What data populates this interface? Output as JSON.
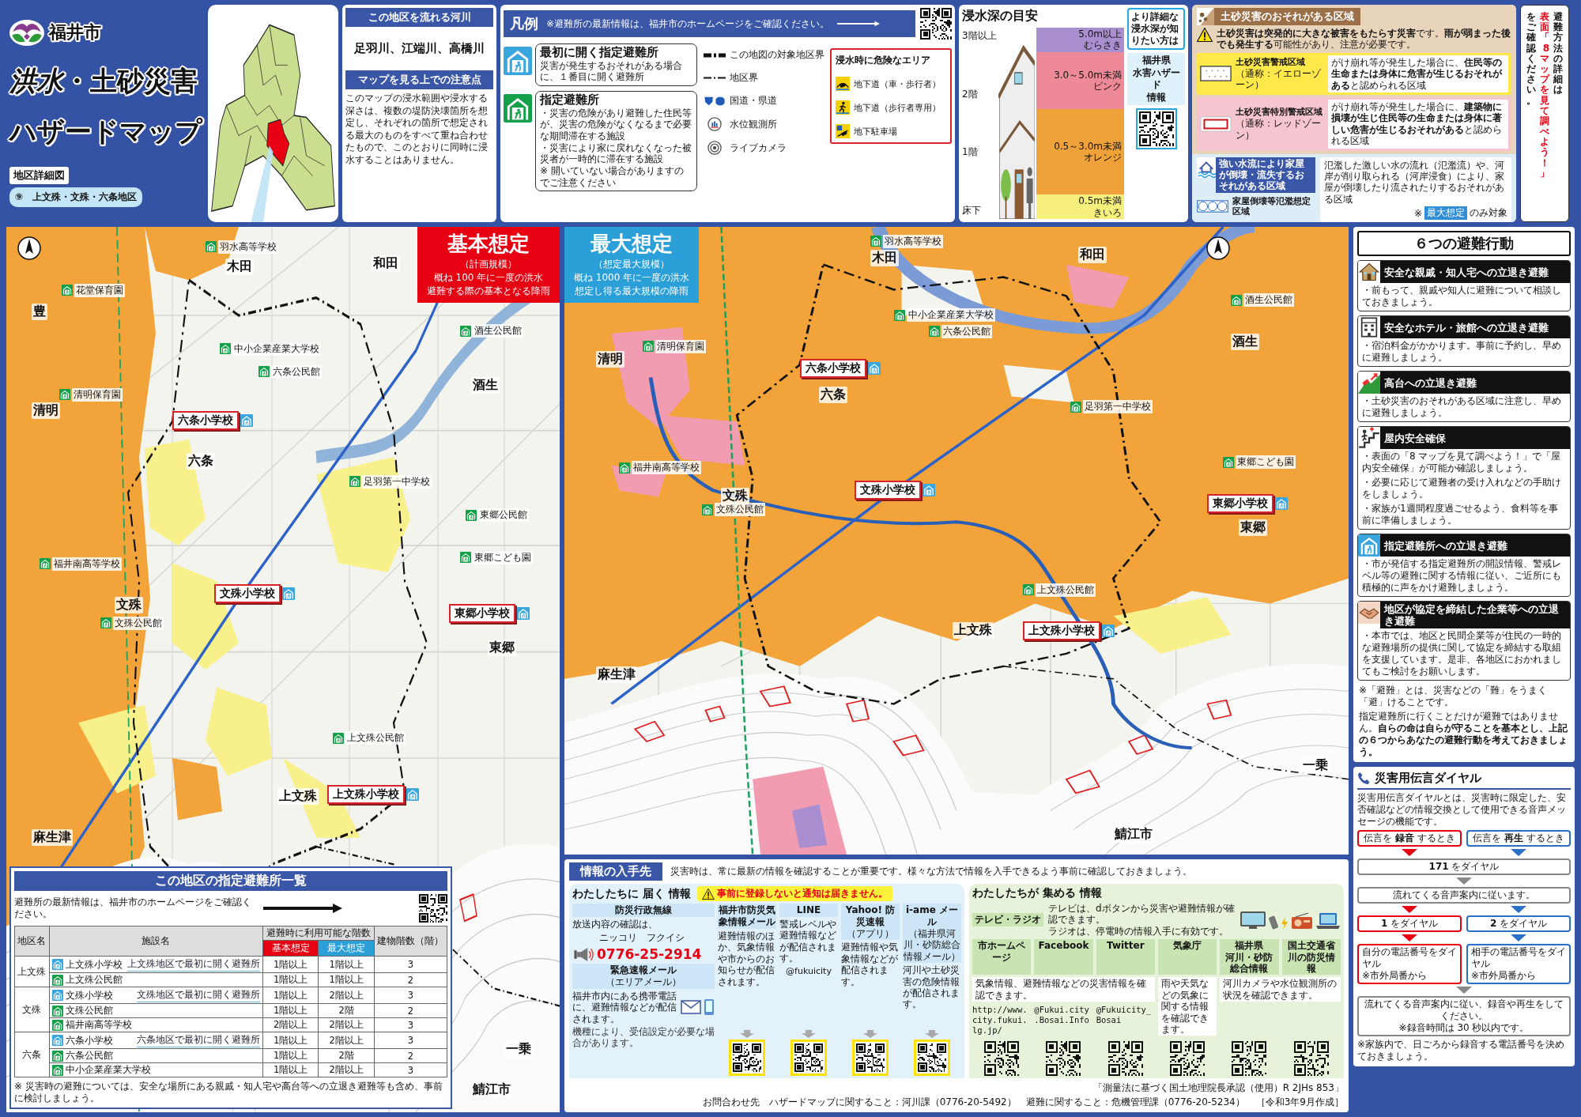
{
  "header": {
    "city": "福井市",
    "title": "*洪水*・**土砂災害**",
    "subtitle": "ハザードマップ",
    "map_type": "地区詳細図",
    "district": "⑨　上文殊・文殊・六条地区"
  },
  "rivers": {
    "heading": "この地区を流れる河川",
    "names": "足羽川、江端川、高橋川"
  },
  "caution": {
    "heading": "マップを見る上での注意点",
    "text": "このマップの浸水範囲や浸水する深さは、複数の堤防決壊箇所を想定し、それぞれの箇所で想定される最大のものをすべて重ね合わせたもので、このとおりに同時に浸水することはありません。"
  },
  "legend": {
    "heading": "凡例",
    "notice": "※避難所の最新情報は、福井市のホームページをご確認ください。",
    "shelters": [
      {
        "kind": "first",
        "title": "最初に開く指定避難所",
        "lines": [
          "災害が発生するおそれがある場合に、１番目に開く避難所"
        ]
      },
      {
        "kind": "designated",
        "title": "指定避難所",
        "lines": [
          "・災害の危険があり避難した住民等が、災害の危険がなくなるまで必要な期間滞在する施設",
          "・災害により家に戻れなくなった被災者が一時的に滞在する施設",
          "※ 開いていない場合がありますのでご注意ください"
        ]
      }
    ],
    "symbols": [
      {
        "kind": "target_boundary",
        "label": "この地図の対象地区界"
      },
      {
        "kind": "boundary",
        "label": "地区界"
      },
      {
        "kind": "road",
        "label": "国道・県道"
      },
      {
        "kind": "gauge",
        "label": "水位観測所"
      },
      {
        "kind": "camera",
        "label": "ライブカメラ"
      }
    ],
    "danger": {
      "heading": "浸水時に危険なエリア",
      "items": [
        {
          "kind": "underpass_car",
          "label": "地下道（車・歩行者）"
        },
        {
          "kind": "underpass_walk",
          "label": "地下道（歩行者専用）"
        },
        {
          "kind": "parking",
          "label": "地下駐車場"
        }
      ]
    }
  },
  "depth_guide": {
    "heading": "浸水深の目安",
    "floors": [
      "3階以上",
      "2階",
      "1階",
      "床下"
    ],
    "bands": [
      {
        "range": "5.0m以上",
        "name": "むらさき",
        "color": "#a98fcf"
      },
      {
        "range": "3.0～5.0m未満",
        "name": "ピンク",
        "color": "#ee8a98"
      },
      {
        "range": "0.5～3.0m未満",
        "name": "オレンジ",
        "color": "#f0a23a"
      },
      {
        "range": "0.5m未満",
        "name": "きいろ",
        "color": "#f6ef7c"
      }
    ],
    "callout": "より詳細な浸水深が知りたい方は",
    "link_lines": [
      "福井県",
      "水害ハザード",
      "情報"
    ]
  },
  "sediment": {
    "heading": "土砂災害のおそれがある区域",
    "warning": "**土砂災害は突発的に大きな被害をもたらす災害**です。**雨が弱まった後でも発生する**可能性があり、注意が必要です。",
    "zones": [
      {
        "kind": "warning",
        "name": "土砂災害警戒区域",
        "alias": "（通称：イエローゾーン）",
        "text": "がけ崩れ等が発生した場合に、**住民等の生命または身体に危害が生じるおそれがある**と認められる区域"
      },
      {
        "kind": "special_warning",
        "name": "土砂災害特別警戒区域",
        "alias": "（通称：レッドゾーン）",
        "text": "がけ崩れ等が発生した場合に、**建築物に損壊が生じ住民等の生命または身体に著しい危害が生じるおそれがある**と認められる区域"
      }
    ],
    "flow": {
      "heading": "強い水流により家屋が倒壊・流失するおそれがある区域",
      "name": "家屋倒壊等氾濫想定区域",
      "text": "氾濫した激しい水の流れ（氾濫流）や、河岸が削り取られる（河岸浸食）により、家屋が倒壊したり流されたりするおそれがある区域",
      "note_mark": "※",
      "note_badge": "最大想定",
      "note_text": "のみ対象"
    }
  },
  "side_note": {
    "text": "避難方法の詳細は**表面「8 マップを見て調べよう！」**をご確認ください。"
  },
  "maps": [
    {
      "kind": "basic",
      "title": "基本想定",
      "scale": "（計画規模）",
      "lines": [
        "概ね 100 年に一度の洪水",
        "避難する際の基本となる降雨"
      ],
      "labels": [
        {
          "kind": "facility",
          "text": "羽水高等学校"
        },
        {
          "kind": "area",
          "text": "木田"
        },
        {
          "kind": "area",
          "text": "和田"
        },
        {
          "kind": "facility",
          "text": "花堂保育園"
        },
        {
          "kind": "area",
          "text": "豊"
        },
        {
          "kind": "facility",
          "text": "中小企業産業大学校"
        },
        {
          "kind": "facility",
          "text": "酒生公民館"
        },
        {
          "kind": "facility",
          "text": "六条公民館"
        },
        {
          "kind": "facility",
          "text": "清明保育園"
        },
        {
          "kind": "area",
          "text": "清明"
        },
        {
          "kind": "area",
          "text": "酒生"
        },
        {
          "kind": "school",
          "text": "六条小学校"
        },
        {
          "kind": "area",
          "text": "六条"
        },
        {
          "kind": "facility",
          "text": "足羽第一中学校"
        },
        {
          "kind": "facility",
          "text": "東郷公民館"
        },
        {
          "kind": "facility",
          "text": "福井南高等学校"
        },
        {
          "kind": "facility",
          "text": "東郷こども園"
        },
        {
          "kind": "school",
          "text": "文殊小学校"
        },
        {
          "kind": "area",
          "text": "文殊"
        },
        {
          "kind": "facility",
          "text": "文殊公民館"
        },
        {
          "kind": "school",
          "text": "東郷小学校"
        },
        {
          "kind": "area",
          "text": "東郷"
        },
        {
          "kind": "facility",
          "text": "上文殊公民館"
        },
        {
          "kind": "area",
          "text": "上文殊"
        },
        {
          "kind": "school",
          "text": "上文殊小学校"
        },
        {
          "kind": "area",
          "text": "麻生津"
        },
        {
          "kind": "area",
          "text": "一乗"
        },
        {
          "kind": "area",
          "text": "鯖江市"
        }
      ]
    },
    {
      "kind": "max",
      "title": "最大想定",
      "scale": "（想定最大規模）",
      "lines": [
        "概ね 1000 年に一度の洪水",
        "想定し得る最大規模の降雨"
      ],
      "labels": [
        {
          "kind": "facility",
          "text": "羽水高等学校"
        },
        {
          "kind": "area",
          "text": "木田"
        },
        {
          "kind": "area",
          "text": "和田"
        },
        {
          "kind": "facility",
          "text": "酒生公民館"
        },
        {
          "kind": "facility",
          "text": "中小企業産業大学校"
        },
        {
          "kind": "facility",
          "text": "六条公民館"
        },
        {
          "kind": "facility",
          "text": "清明保育園"
        },
        {
          "kind": "area",
          "text": "清明"
        },
        {
          "kind": "area",
          "text": "酒生"
        },
        {
          "kind": "school",
          "text": "六条小学校"
        },
        {
          "kind": "area",
          "text": "六条"
        },
        {
          "kind": "facility",
          "text": "足羽第一中学校"
        },
        {
          "kind": "facility",
          "text": "東郷こども園"
        },
        {
          "kind": "facility",
          "text": "福井南高等学校"
        },
        {
          "kind": "school",
          "text": "文殊小学校"
        },
        {
          "kind": "area",
          "text": "文殊"
        },
        {
          "kind": "facility",
          "text": "文殊公民館"
        },
        {
          "kind": "school",
          "text": "東郷小学校"
        },
        {
          "kind": "area",
          "text": "東郷"
        },
        {
          "kind": "facility",
          "text": "上文殊公民館"
        },
        {
          "kind": "area",
          "text": "上文殊"
        },
        {
          "kind": "school",
          "text": "上文殊小学校"
        },
        {
          "kind": "area",
          "text": "麻生津"
        },
        {
          "kind": "area",
          "text": "一乗"
        },
        {
          "kind": "area",
          "text": "鯖江市"
        }
      ]
    }
  ],
  "shelter_list": {
    "heading": "この地区の指定避難所一覧",
    "notice": "避難所の最新情報は、福井市のホームページをご確認ください。",
    "headers": {
      "district": "地区名",
      "facility": "施設名",
      "usable": "避難時に利用可能な階数",
      "basic": "基本想定",
      "max": "最大想定",
      "floors": "建物階数（階）"
    },
    "groups": [
      {
        "district": "上文殊",
        "rows": [
          {
            "kind": "first",
            "name": "上文殊小学校",
            "note": "上文殊地区で最初に開く避難所",
            "basic": "1階以上",
            "max": "1階以上",
            "floors": "3"
          },
          {
            "kind": "designated",
            "name": "上文殊公民館",
            "basic": "1階以上",
            "max": "1階以上",
            "floors": "2"
          }
        ]
      },
      {
        "district": "文殊",
        "rows": [
          {
            "kind": "first",
            "name": "文殊小学校",
            "note": "文殊地区で最初に開く避難所",
            "basic": "1階以上",
            "max": "2階以上",
            "floors": "3"
          },
          {
            "kind": "designated",
            "name": "文殊公民館",
            "basic": "1階以上",
            "max": "2階",
            "floors": "2"
          },
          {
            "kind": "designated",
            "name": "福井南高等学校",
            "basic": "2階以上",
            "max": "2階以上",
            "floors": "3"
          }
        ]
      },
      {
        "district": "六条",
        "rows": [
          {
            "kind": "first",
            "name": "六条小学校",
            "note": "六条地区で最初に開く避難所",
            "basic": "1階以上",
            "max": "2階以上",
            "floors": "3"
          },
          {
            "kind": "designated",
            "name": "六条公民館",
            "basic": "1階以上",
            "max": "2階",
            "floors": "2"
          },
          {
            "kind": "designated",
            "name": "中小企業産業大学校",
            "basic": "1階以上",
            "max": "2階以上",
            "floors": "3"
          }
        ]
      }
    ],
    "footnote": "※ 災害時の避難については、安全な場所にある親戚・知人宅や高台等への立退き避難等も含め、事前に検討しましょう。"
  },
  "actions": {
    "heading": "６つの避難行動",
    "items": [
      {
        "kind": "relatives",
        "title": "安全な親戚・知人宅への立退き避難",
        "points": [
          "・前もって、親戚や知人に避難について相談しておきましょう。"
        ]
      },
      {
        "kind": "hotel",
        "title": "安全なホテル・旅館への立退き避難",
        "points": [
          "・宿泊料金がかかります。事前に予約し、早めに避難しましょう。"
        ]
      },
      {
        "kind": "high_ground",
        "title": "高台への立退き避難",
        "points": [
          "・土砂災害のおそれがある区域に注意し、早めに避難しましょう。"
        ]
      },
      {
        "kind": "indoor",
        "title": "屋内安全確保",
        "points": [
          "・表面の「8 マップを見て調べよう！」で「屋内安全確保」が可能か確認しましょう。",
          "・必要に応じて避難者の受け入れなどの手助けをしましょう。",
          "・家族が1週間程度過ごせるよう、食料等を事前に準備しましょう。"
        ]
      },
      {
        "kind": "shelter",
        "title": "指定避難所への立退き避難",
        "points": [
          "・市が発信する指定避難所の開設情報、警戒レベル等の避難に関する情報に従い、ご近所にも積極的に声をかけ避難しましょう。"
        ]
      },
      {
        "kind": "company",
        "title": "地区が協定を締結した企業等への立退き避難",
        "points": [
          "・本市では、地区と民間企業等が住民の一時的な避難場所の提供に関して協定を締結する取組を支援しています。是非、各地区におかれましてもご検討をお願いします。"
        ]
      }
    ],
    "definition": "※「避難」とは、災害などの「難」をうまく「避」けることです。",
    "advice": "指定避難所に行くことだけが避難ではありません。**自らの命は自らが守ることを基本とし、上記の６つからあなたの避難行動を考えておきましょう。**"
  },
  "dial": {
    "heading": "災害用伝言ダイヤル",
    "intro": "災害用伝言ダイヤルとは、災害時に限定した、安否確認などの情報交換として使用できる音声メッセージの機能です。",
    "modes": [
      {
        "kind": "record",
        "label": "伝言を **録音** するとき",
        "key": "**1** をダイヤル",
        "target": "自分の電話番号をダイヤル",
        "target_note": "※市外局番から"
      },
      {
        "kind": "play",
        "label": "伝言を **再生** するとき",
        "key": "**2** をダイヤル",
        "target": "相手の電話番号をダイヤル",
        "target_note": "※市外局番から"
      }
    ],
    "number": "**171** をダイヤル",
    "guide": "流れてくる音声案内に従います。",
    "final": "流れてくる音声案内に従い、録音や再生をしてください。",
    "final_note": "※録音時間は 30 秒以内です。",
    "tip": "※家族内で、日ごろから録音する電話番号を決めておきましょう。"
  },
  "info": {
    "heading": "情報の入手先",
    "intro": "災害時は、常に最新の情報を確認することが重要です。様々な方法で情報を入手できるよう事前に確認しておきましょう。",
    "push": {
      "title": "わたしたちに **届く** 情報",
      "warning": "事前に登録しないと通知は届きません。",
      "sources": [
        {
          "kind": "broadcast",
          "title": "防災行政無線",
          "text": "放送内容の確認は、",
          "reading": "ニッコリ　フクイシ",
          "phone": "0776-25-2914"
        },
        {
          "kind": "area_mail",
          "title": "緊急速報メール",
          "sub": "（エリアメール）",
          "text": "福井市内にある携帯電話に、避難情報などが配信されます。",
          "note": "機種により、受信設定が必要な場合があります。"
        },
        {
          "kind": "service",
          "title": "福井市防災気象情報メール",
          "text": "避難情報のほか、気象情報や市からのお知らせが配信されます。"
        },
        {
          "kind": "service",
          "title": "LINE",
          "text": "警戒レベルや避難情報などが配信されます。",
          "handle": "@fukuicity"
        },
        {
          "kind": "service",
          "title": "Yahoo! 防災速報",
          "sub": "（アプリ）",
          "text": "避難情報や気象情報などが配信されます。"
        },
        {
          "kind": "service",
          "title": "i-ame メール",
          "sub": "（福井県河川・砂防総合情報メール）",
          "text": "河川や土砂災害の危険情報が配信されます。"
        }
      ]
    },
    "pull": {
      "title": "わたしたちが **集める** 情報",
      "tv": {
        "title": "テレビ・ラジオ",
        "lines": [
          "テレビは、dボタンから災害や避難情報が確認できます。",
          "ラジオは、停電時の情報入手に有効です。"
        ]
      },
      "groups": [
        {
          "text": "気象情報、避難情報などの災害情報を確認できます。",
          "sources": [
            {
              "title": "市ホームページ",
              "handle": "http://www.city.fukui.lg.jp/"
            },
            {
              "title": "Facebook",
              "handle": "@Fukui.city.Bosai.Info"
            },
            {
              "title": "Twitter",
              "handle": "@Fukuicity_Bosai"
            }
          ]
        },
        {
          "text": "雨や天気などの気象に関する情報を確認できます。",
          "sources": [
            {
              "title": "気象庁"
            }
          ]
        },
        {
          "text": "河川カメラや水位観測所の状況を確認できます。",
          "sources": [
            {
              "title_lines": [
                "福井県",
                "河川・砂防総合情報"
              ]
            },
            {
              "title_lines": [
                "国土交通省",
                "川の防災情報"
              ]
            }
          ]
        }
      ]
    }
  },
  "footer": {
    "survey": "「測量法に基づく国土地理院長承認（使用）R 2JHs 853」",
    "contact": "お問合わせ先　ハザードマップに関すること：河川課（0776-20-5492）　避難に関すること：危機管理課（0776-20-5234）",
    "date": "［令和3年9月作成］"
  }
}
